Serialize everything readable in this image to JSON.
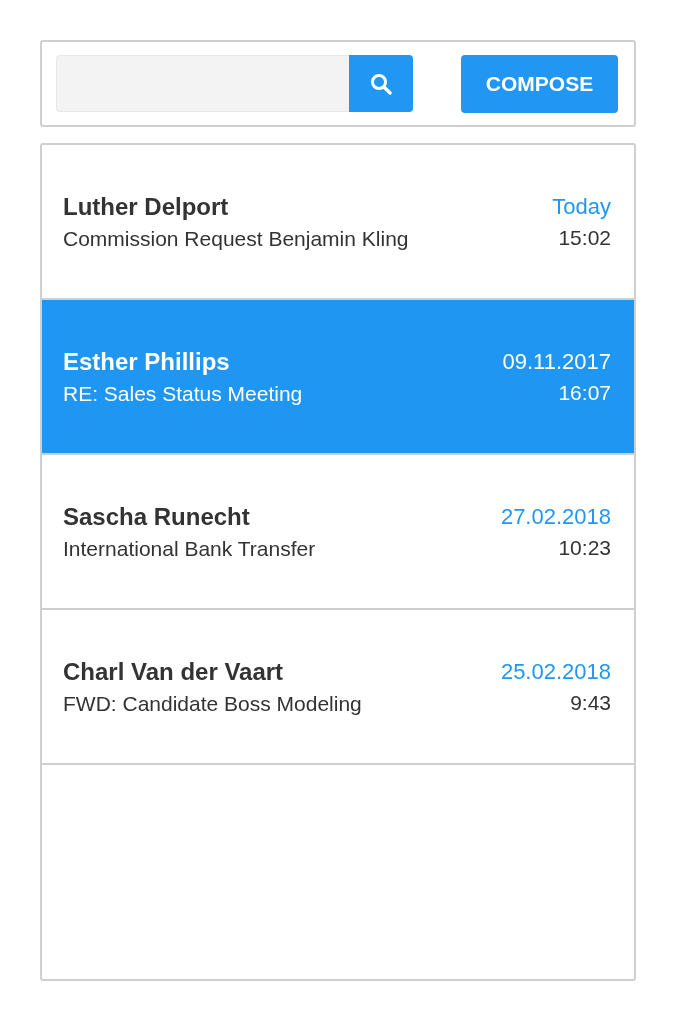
{
  "toolbar": {
    "compose_label": "COMPOSE"
  },
  "messages": [
    {
      "sender": "Luther Delport",
      "subject": "Commission Request Benjamin Kling",
      "date": "Today",
      "time": "15:02",
      "selected": false
    },
    {
      "sender": "Esther Phillips",
      "subject": "RE: Sales Status Meeting",
      "date": "09.11.2017",
      "time": "16:07",
      "selected": true
    },
    {
      "sender": "Sascha Runecht",
      "subject": "International Bank Transfer",
      "date": "27.02.2018",
      "time": "10:23",
      "selected": false
    },
    {
      "sender": "Charl Van der Vaart",
      "subject": "FWD: Candidate Boss Modeling",
      "date": "25.02.2018",
      "time": "9:43",
      "selected": false
    }
  ]
}
